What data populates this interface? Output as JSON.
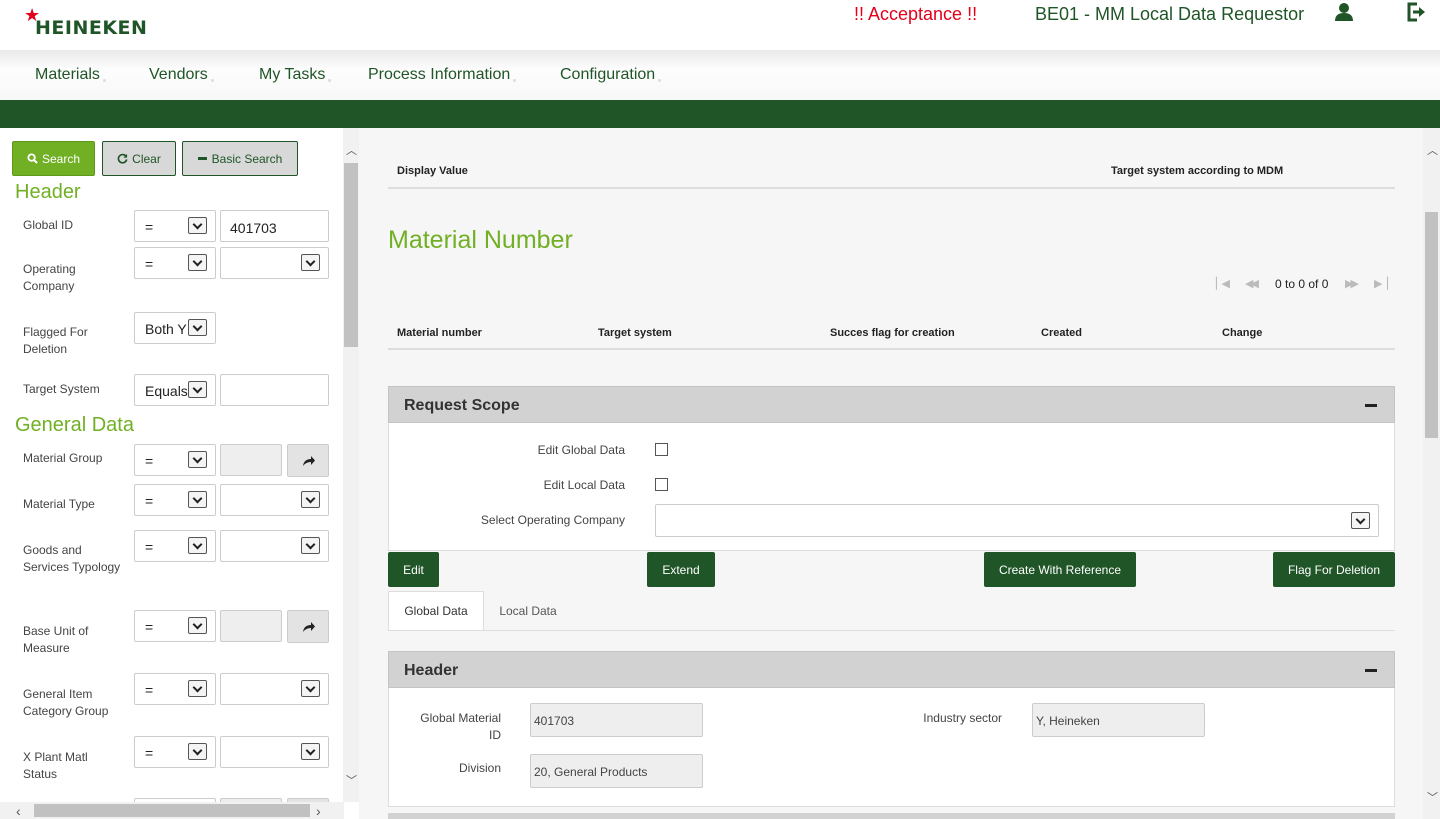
{
  "header": {
    "logo_text": "HEINEKEN",
    "environment": "!! Acceptance !!",
    "role": "BE01 - MM Local Data Requestor",
    "user_icon": "user-icon",
    "logout_icon": "logout-icon"
  },
  "nav": {
    "items": [
      "Materials",
      "Vendors",
      "My Tasks",
      "Process Information",
      "Configuration"
    ]
  },
  "search_panel": {
    "search_label": "Search",
    "clear_label": "Clear",
    "basic_search_label": "Basic Search",
    "header_title": "Header",
    "general_title": "General Data",
    "fields": {
      "global_id": {
        "label": "Global ID",
        "operator": "=",
        "value": "401703"
      },
      "operating_company": {
        "label": "Operating Company",
        "operator": "=",
        "value": ""
      },
      "flagged_for_deletion": {
        "label": "Flagged For Deletion",
        "value": "Both Y"
      },
      "target_system": {
        "label": "Target System",
        "operator": "Equals",
        "value": ""
      },
      "material_group": {
        "label": "Material Group",
        "operator": "=",
        "value": ""
      },
      "material_type": {
        "label": "Material Type",
        "operator": "=",
        "value": ""
      },
      "goods_services": {
        "label": "Goods and Services Typology",
        "operator": "=",
        "value": ""
      },
      "base_unit": {
        "label": "Base Unit of Measure",
        "operator": "=",
        "value": ""
      },
      "item_category": {
        "label": "General Item Category Group",
        "operator": "=",
        "value": ""
      },
      "plant_status": {
        "label": "X Plant Matl Status",
        "operator": "=",
        "value": ""
      }
    }
  },
  "main": {
    "display_table": {
      "col_display_value": "Display Value",
      "col_target_system": "Target system according to MDM"
    },
    "material_number_title": "Material Number",
    "pager_text": "0 to 0 of 0",
    "material_table": {
      "columns": [
        "Material number",
        "Target system",
        "Succes flag for creation",
        "Created",
        "Change"
      ]
    },
    "request_scope": {
      "title": "Request Scope",
      "edit_global": "Edit Global Data",
      "edit_local": "Edit Local Data",
      "select_opco": "Select Operating Company",
      "select_opco_value": ""
    },
    "actions": {
      "edit": "Edit",
      "extend": "Extend",
      "create_ref": "Create With Reference",
      "flag_delete": "Flag For Deletion"
    },
    "tabs": [
      "Global Data",
      "Local Data"
    ],
    "header_section": {
      "title": "Header",
      "global_material_id_label": "Global Material ID",
      "global_material_id": "401703",
      "division_label": "Division",
      "division": "20, General Products",
      "industry_sector_label": "Industry sector",
      "industry_sector": "Y, Heineken"
    }
  },
  "colors": {
    "brand_green": "#205527",
    "accent_green": "#71b024",
    "alert_red": "#e2001a"
  }
}
